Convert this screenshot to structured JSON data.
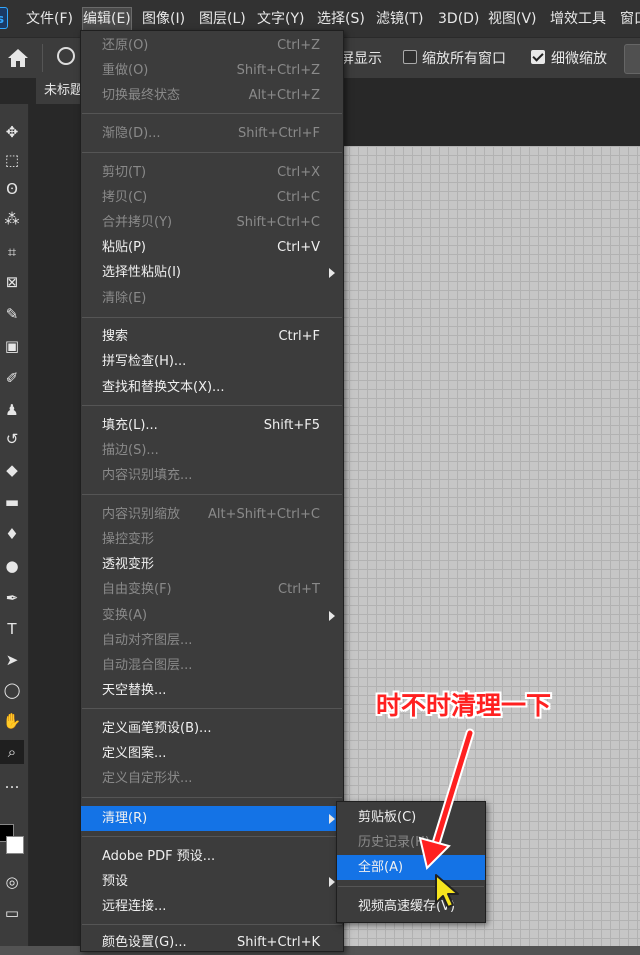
{
  "app": {
    "logo_text": "s"
  },
  "menubar": {
    "items": [
      {
        "label": "文件(F)"
      },
      {
        "label": "编辑(E)"
      },
      {
        "label": "图像(I)"
      },
      {
        "label": "图层(L)"
      },
      {
        "label": "文字(Y)"
      },
      {
        "label": "选择(S)"
      },
      {
        "label": "滤镜(T)"
      },
      {
        "label": "3D(D)"
      },
      {
        "label": "视图(V)"
      },
      {
        "label": "增效工具"
      },
      {
        "label": "窗口"
      }
    ]
  },
  "options_bar": {
    "partial_label": "屏显示",
    "resize_windows_label": "缩放所有窗口",
    "resize_windows_checked": false,
    "scrubby_zoom_label": "细微缩放",
    "scrubby_zoom_checked": true
  },
  "document": {
    "tab_title": "未标题"
  },
  "edit_menu": {
    "items": [
      {
        "label": "还原(O)",
        "shortcut": "Ctrl+Z",
        "enabled": false
      },
      {
        "label": "重做(O)",
        "shortcut": "Shift+Ctrl+Z",
        "enabled": false
      },
      {
        "label": "切换最终状态",
        "shortcut": "Alt+Ctrl+Z",
        "enabled": false
      },
      {
        "label": "渐隐(D)...",
        "shortcut": "Shift+Ctrl+F",
        "enabled": false
      },
      {
        "label": "剪切(T)",
        "shortcut": "Ctrl+X",
        "enabled": false
      },
      {
        "label": "拷贝(C)",
        "shortcut": "Ctrl+C",
        "enabled": false
      },
      {
        "label": "合并拷贝(Y)",
        "shortcut": "Shift+Ctrl+C",
        "enabled": false
      },
      {
        "label": "粘贴(P)",
        "shortcut": "Ctrl+V",
        "enabled": true
      },
      {
        "label": "选择性粘贴(I)",
        "shortcut": "",
        "enabled": true,
        "submenu": true
      },
      {
        "label": "清除(E)",
        "shortcut": "",
        "enabled": false
      },
      {
        "label": "搜索",
        "shortcut": "Ctrl+F",
        "enabled": true
      },
      {
        "label": "拼写检查(H)...",
        "shortcut": "",
        "enabled": true
      },
      {
        "label": "查找和替换文本(X)...",
        "shortcut": "",
        "enabled": true
      },
      {
        "label": "填充(L)...",
        "shortcut": "Shift+F5",
        "enabled": true
      },
      {
        "label": "描边(S)...",
        "shortcut": "",
        "enabled": false
      },
      {
        "label": "内容识别填充...",
        "shortcut": "",
        "enabled": false
      },
      {
        "label": "内容识别缩放",
        "shortcut": "Alt+Shift+Ctrl+C",
        "enabled": false
      },
      {
        "label": "操控变形",
        "shortcut": "",
        "enabled": false
      },
      {
        "label": "透视变形",
        "shortcut": "",
        "enabled": true
      },
      {
        "label": "自由变换(F)",
        "shortcut": "Ctrl+T",
        "enabled": false
      },
      {
        "label": "变换(A)",
        "shortcut": "",
        "enabled": false,
        "submenu": true
      },
      {
        "label": "自动对齐图层...",
        "shortcut": "",
        "enabled": false
      },
      {
        "label": "自动混合图层...",
        "shortcut": "",
        "enabled": false
      },
      {
        "label": "天空替换...",
        "shortcut": "",
        "enabled": true
      },
      {
        "label": "定义画笔预设(B)...",
        "shortcut": "",
        "enabled": true
      },
      {
        "label": "定义图案...",
        "shortcut": "",
        "enabled": true
      },
      {
        "label": "定义自定形状...",
        "shortcut": "",
        "enabled": false
      },
      {
        "label": "清理(R)",
        "shortcut": "",
        "enabled": true,
        "submenu": true,
        "highlighted": true
      },
      {
        "label": "Adobe PDF 预设...",
        "shortcut": "",
        "enabled": true
      },
      {
        "label": "预设",
        "shortcut": "",
        "enabled": true,
        "submenu": true
      },
      {
        "label": "远程连接...",
        "shortcut": "",
        "enabled": true
      },
      {
        "label": "颜色设置(G)...",
        "shortcut": "Shift+Ctrl+K",
        "enabled": true
      }
    ]
  },
  "purge_submenu": {
    "items": [
      {
        "label": "剪贴板(C)",
        "enabled": true
      },
      {
        "label": "历史记录(H)",
        "enabled": false
      },
      {
        "label": "全部(A)",
        "enabled": true,
        "highlighted": true
      },
      {
        "label": "视频高速缓存(V)",
        "enabled": true
      }
    ]
  },
  "annotation": {
    "text": "时不时清理一下",
    "color": "#ff2020"
  },
  "colors": {
    "accent": "#1473e6",
    "menu_bg": "#3c3c3c",
    "menubar_bg": "#323232"
  },
  "tools": [
    {
      "name": "move-tool",
      "glyph": "✥"
    },
    {
      "name": "marquee-tool",
      "glyph": "⬚"
    },
    {
      "name": "lasso-tool",
      "glyph": "ʘ"
    },
    {
      "name": "magic-wand-tool",
      "glyph": "⁂"
    },
    {
      "name": "crop-tool",
      "glyph": "⌗"
    },
    {
      "name": "frame-tool",
      "glyph": "⊠"
    },
    {
      "name": "eyedropper-tool",
      "glyph": "✎"
    },
    {
      "name": "healing-brush-tool",
      "glyph": "▣"
    },
    {
      "name": "brush-tool",
      "glyph": "✐"
    },
    {
      "name": "stamp-tool",
      "glyph": "♟"
    },
    {
      "name": "history-brush-tool",
      "glyph": "↺"
    },
    {
      "name": "eraser-tool",
      "glyph": "◆"
    },
    {
      "name": "gradient-tool",
      "glyph": "▬"
    },
    {
      "name": "blur-tool",
      "glyph": "♦"
    },
    {
      "name": "dodge-tool",
      "glyph": "●"
    },
    {
      "name": "pen-tool",
      "glyph": "✒"
    },
    {
      "name": "type-tool",
      "glyph": "T"
    },
    {
      "name": "path-selection-tool",
      "glyph": "➤"
    },
    {
      "name": "shape-tool",
      "glyph": "◯"
    },
    {
      "name": "hand-tool",
      "glyph": "✋"
    },
    {
      "name": "zoom-tool",
      "glyph": "⌕"
    },
    {
      "name": "more-tools",
      "glyph": "…"
    }
  ]
}
